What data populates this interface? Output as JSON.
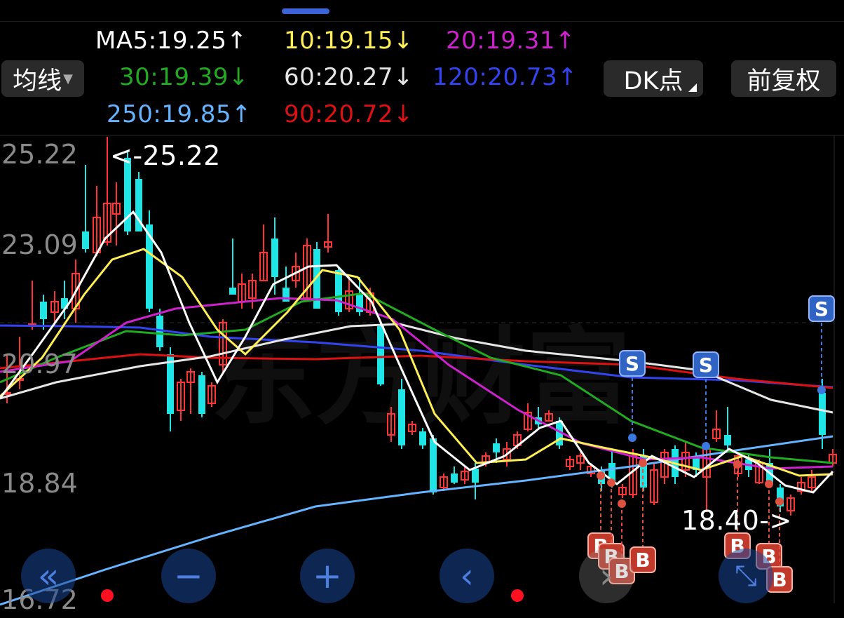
{
  "ma_legend": {
    "ma5": "MA5:19.25↑",
    "ma10": "10:19.15↓",
    "ma20": "20:19.31↑",
    "ma30": "30:19.39↓",
    "ma60": "60:20.27↓",
    "ma120": "120:20.73↑",
    "ma250": "250:19.85↑",
    "ma90": "90:20.72↓"
  },
  "controls": {
    "ma_button": "均线",
    "dk_button": "DK点",
    "adjust_button": "前复权"
  },
  "y_axis": {
    "labels": [
      "25.22",
      "23.09",
      "20.97",
      "18.84",
      "16.72"
    ]
  },
  "annotations": {
    "high": "<-25.22",
    "low": "18.40->"
  },
  "watermark": "东方财富",
  "signals": {
    "sell": "S",
    "buy": "B"
  },
  "colors": {
    "up": "#ff3333",
    "down": "#1fe6e6",
    "ma5": "#ffffff",
    "ma10": "#ffee55",
    "ma20": "#cc22cc",
    "ma30": "#22aa22",
    "ma60": "#e6e6e6",
    "ma120": "#3344ee",
    "ma250": "#66b3ff",
    "ma90": "#dd1111"
  },
  "nav": {
    "left_fast_icon": "double-chevron-left-icon",
    "zoom_out_icon": "minus-icon",
    "zoom_in_icon": "plus-icon",
    "prev_icon": "chevron-left-icon",
    "next_icon": "chevron-right-icon",
    "expand_icon": "expand-arrows-icon"
  }
}
